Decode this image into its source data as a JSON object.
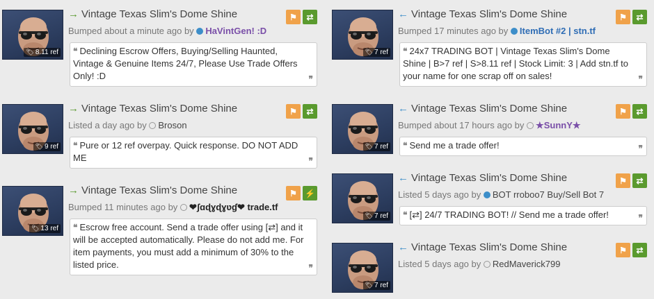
{
  "item_name": "Vintage Texas Slim's Dome Shine",
  "icons": {
    "sell_arrow": "→",
    "buy_arrow": "←",
    "flag": "⚑",
    "trade": "⇄",
    "instant": "⚡",
    "tag": "🏷",
    "quote_open": "❝",
    "quote_close": "❞"
  },
  "colors": {
    "sell": "#5a9a2e",
    "buy": "#3d8ec9",
    "flag_btn": "#f0a24a",
    "trade_btn": "#5a9a2e"
  },
  "sell_listings": [
    {
      "price": "8.11 ref",
      "status": "Bumped about a minute ago by",
      "user": "HaVintGen! :D",
      "message": "Declining Escrow Offers, Buying/Selling Haunted, Vintage & Genuine Items 24/7, Please Use Trade Offers Only! :D"
    },
    {
      "price": "9 ref",
      "status": "Listed a day ago by",
      "user": "Broson",
      "message": "Pure or 12 ref overpay. Quick response. DO NOT ADD ME"
    },
    {
      "price": "13 ref",
      "status": "Bumped 11 minutes ago by",
      "user": "❤ʃɑɖɣɖɣʋɠ❤ trade.tf",
      "message": "Escrow free account. Send a trade offer using [⇄] and it will be accepted automatically. Please do not add me. For item payments, you must add a minimum of 30% to the listed price."
    }
  ],
  "buy_listings": [
    {
      "price": "7 ref",
      "status": "Bumped 17 minutes ago by",
      "user": "ItemBot #2 | stn.tf",
      "message": "24x7 TRADING BOT | Vintage Texas Slim's Dome Shine | B>7 ref | S>8.11 ref | Stock Limit: 3 | Add stn.tf to your name for one scrap off on sales!"
    },
    {
      "price": "7 ref",
      "status": "Bumped about 17 hours ago by",
      "user": "★SunnY★",
      "message": "Send me a trade offer!"
    },
    {
      "price": "7 ref",
      "status": "Listed 5 days ago by",
      "user": "BOT rroboo7 Buy/Sell Bot 7",
      "message": "[⇄] 24/7 TRADING BOT! // Send me a trade offer!"
    },
    {
      "price": "7 ref",
      "status": "Listed 5 days ago by",
      "user": "RedMaverick799",
      "message": ""
    }
  ]
}
